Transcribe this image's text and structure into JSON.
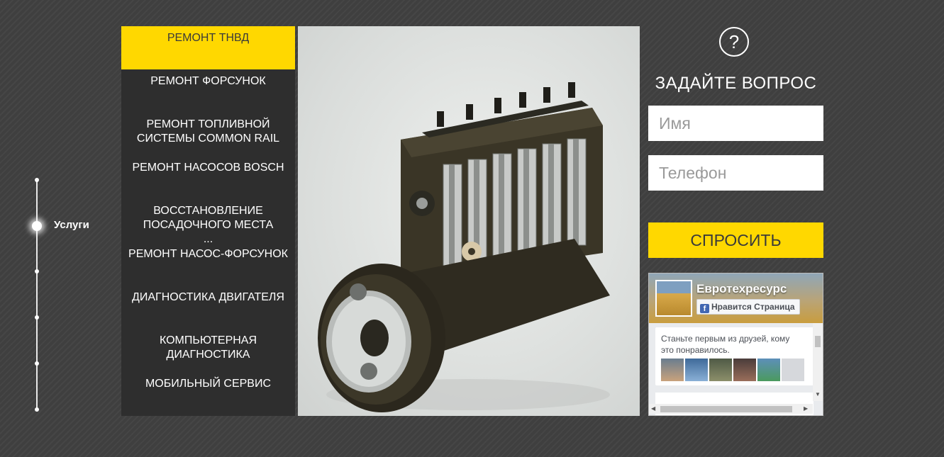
{
  "timeline": {
    "active_label": "Услуги"
  },
  "menu": {
    "items": [
      {
        "label": "РЕМОНТ ТНВД",
        "active": true
      },
      {
        "label": "РЕМОНТ ФОРСУНОК"
      },
      {
        "label": "РЕМОНТ ТОПЛИВНОЙ СИСТЕМЫ COMMON RAIL"
      },
      {
        "label": "РЕМОНТ НАСОСОВ BOSCH"
      },
      {
        "label": "ВОССТАНОВЛЕНИЕ ПОСАДОЧНОГО МЕСТА ..."
      },
      {
        "label": "РЕМОНТ НАСОС-ФОРСУНОК"
      },
      {
        "label": "ДИАГНОСТИКА ДВИГАТЕЛЯ"
      },
      {
        "label": "КОМПЬЮТЕРНАЯ ДИАГНОСТИКА"
      },
      {
        "label": "МОБИЛЬНЫЙ СЕРВИС"
      }
    ]
  },
  "ask": {
    "icon": "question-icon",
    "icon_glyph": "?",
    "title": "ЗАДАЙТЕ ВОПРОС",
    "name_placeholder": "Имя",
    "phone_placeholder": "Телефон",
    "submit_label": "СПРОСИТЬ"
  },
  "fb": {
    "page_name": "Евротехресурс",
    "like_label": "Нравится Страница",
    "like_icon": "f",
    "social_text": "Станьте первым из друзей, кому это понравилось."
  },
  "colors": {
    "accent": "#ffd800",
    "menu_bg": "#2e2e2e",
    "page_bg": "#3f3f3f"
  }
}
